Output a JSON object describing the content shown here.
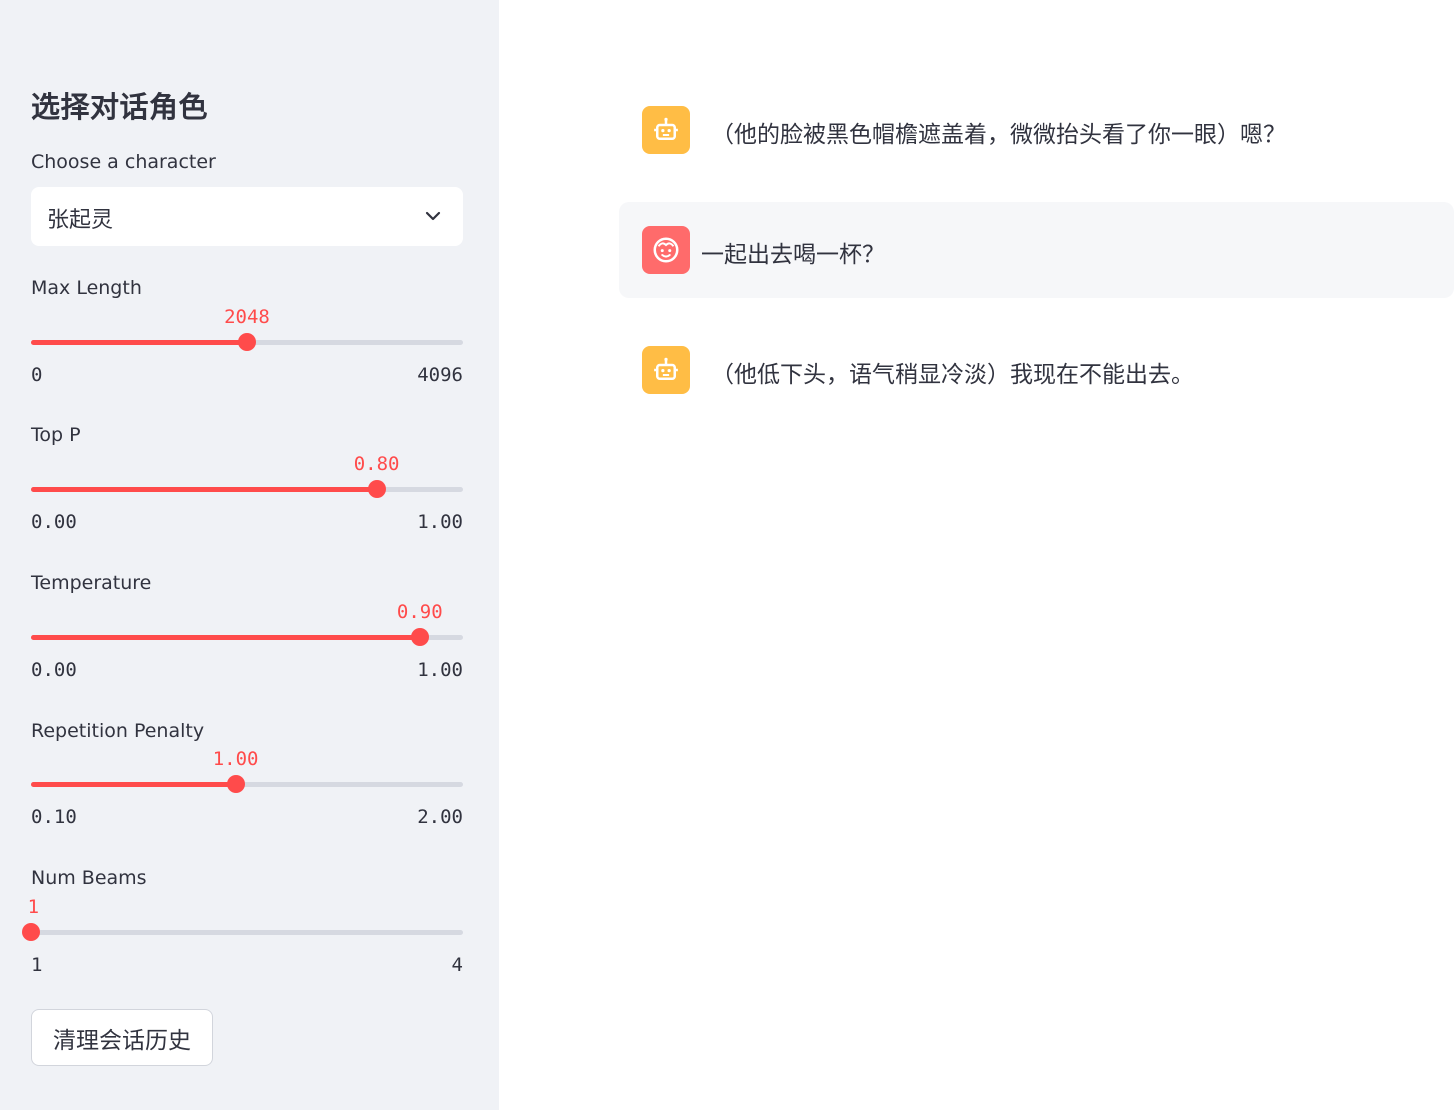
{
  "sidebar": {
    "title": "选择对话角色",
    "character_label": "Choose a character",
    "character_value": "张起灵",
    "sliders": [
      {
        "label": "Max Length",
        "value": "2048",
        "min": "0",
        "max": "4096",
        "fraction": 0.5
      },
      {
        "label": "Top P",
        "value": "0.80",
        "min": "0.00",
        "max": "1.00",
        "fraction": 0.8
      },
      {
        "label": "Temperature",
        "value": "0.90",
        "min": "0.00",
        "max": "1.00",
        "fraction": 0.9
      },
      {
        "label": "Repetition Penalty",
        "value": "1.00",
        "min": "0.10",
        "max": "2.00",
        "fraction": 0.4737
      },
      {
        "label": "Num Beams",
        "value": "1",
        "min": "1",
        "max": "4",
        "fraction": 0.0
      }
    ],
    "clear_button": "清理会话历史"
  },
  "chat": {
    "messages": [
      {
        "role": "assistant",
        "icon": "robot-icon",
        "text": "（他的脸被黑色帽檐遮盖着，微微抬头看了你一眼）嗯？"
      },
      {
        "role": "user",
        "icon": "smiley-face-icon",
        "text": "一起出去喝一杯？"
      },
      {
        "role": "assistant",
        "icon": "robot-icon",
        "text": "（他低下头，语气稍显冷淡）我现在不能出去。"
      }
    ]
  },
  "colors": {
    "accent": "#ff4b4b",
    "sidebar_bg": "#f0f2f6",
    "bot_avatar": "#ffbd45",
    "user_avatar": "#ff6b6b"
  }
}
